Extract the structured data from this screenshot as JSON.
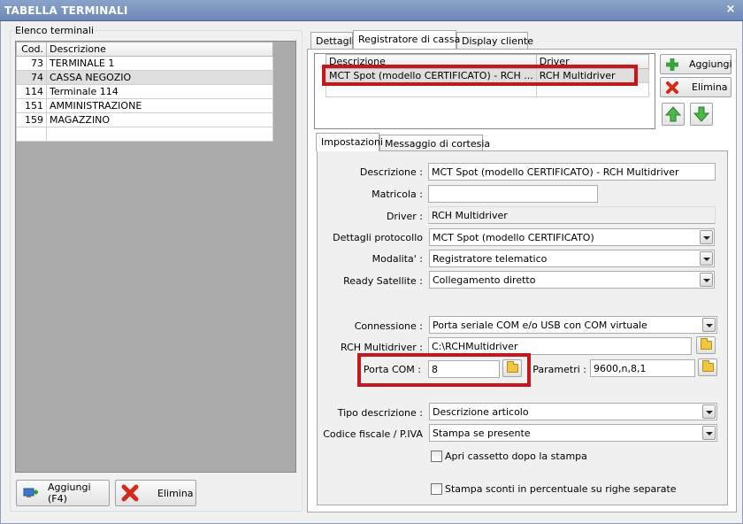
{
  "window": {
    "title": "TABELLA TERMINALI",
    "close_label": "×"
  },
  "left": {
    "group_label": "Elenco terminali",
    "columns": {
      "cod": "Cod.",
      "descrizione": "Descrizione"
    },
    "rows": [
      {
        "cod": "73",
        "descrizione": "TERMINALE 1"
      },
      {
        "cod": "74",
        "descrizione": "CASSA NEGOZIO"
      },
      {
        "cod": "114",
        "descrizione": "Terminale 114"
      },
      {
        "cod": "151",
        "descrizione": "AMMINISTRAZIONE"
      },
      {
        "cod": "159",
        "descrizione": "MAGAZZINO"
      }
    ],
    "add_button": "Aggiungi (F4)",
    "delete_button": "Elimina"
  },
  "tabs": {
    "dettagli": "Dettagli",
    "registratore": "Registratore di cassa",
    "display": "Display cliente"
  },
  "driver_grid": {
    "columns": {
      "descrizione": "Descrizione",
      "driver": "Driver"
    },
    "row": {
      "descrizione": "MCT Spot (modello CERTIFICATO) - RCH ...",
      "driver": "RCH Multidriver"
    }
  },
  "side_buttons": {
    "add": "Aggiungi",
    "delete": "Elimina"
  },
  "subtabs": {
    "impostazioni": "Impostazioni",
    "messaggio": "Messaggio di cortesia"
  },
  "form": {
    "descrizione_label": "Descrizione :",
    "descrizione_value": "MCT Spot (modello CERTIFICATO) - RCH Multidriver",
    "matricola_label": "Matricola :",
    "matricola_value": "",
    "driver_label": "Driver :",
    "driver_value": "RCH Multidriver",
    "dettagli_label": "Dettagli protocollo",
    "dettagli_value": "MCT Spot (modello CERTIFICATO)",
    "modalita_label": "Modalita' :",
    "modalita_value": "Registratore telematico",
    "ready_label": "Ready Satellite :",
    "ready_value": "Collegamento diretto",
    "connessione_label": "Connessione :",
    "connessione_value": "Porta seriale COM e/o USB con COM virtuale",
    "rch_label": "RCH Multidriver :",
    "rch_value": "C:\\RCHMultidriver",
    "porta_label": "Porta COM :",
    "porta_value": "8",
    "parametri_label": "Parametri :",
    "parametri_value": "9600,n,8,1",
    "tipo_label": "Tipo descrizione :",
    "tipo_value": "Descrizione articolo",
    "codfisc_label": "Codice fiscale / P.IVA",
    "codfisc_value": "Stampa se presente",
    "cassetto_label": "Apri cassetto dopo la stampa",
    "sconti_label": "Stampa sconti in percentuale su righe separate"
  },
  "colors": {
    "highlight": "#c8161d",
    "titlebar": "#7690bc"
  }
}
